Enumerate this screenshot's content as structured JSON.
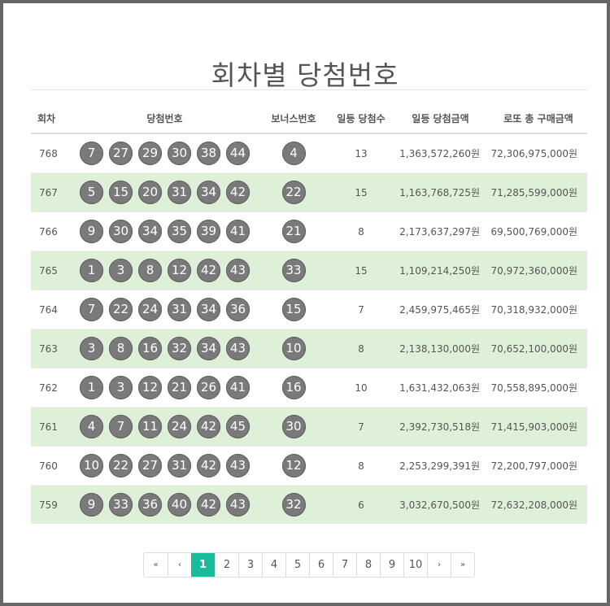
{
  "title": "회차별 당첨번호",
  "columns": {
    "round": "회차",
    "numbers": "당첨번호",
    "bonus": "보너스번호",
    "winners": "일등 당첨수",
    "prize": "일등 당첨금액",
    "total": "로또 총 구매금액"
  },
  "rows": [
    {
      "round": "768",
      "numbers": [
        "7",
        "27",
        "29",
        "30",
        "38",
        "44"
      ],
      "bonus": "4",
      "winners": "13",
      "prize": "1,363,572,260원",
      "total": "72,306,975,000원"
    },
    {
      "round": "767",
      "numbers": [
        "5",
        "15",
        "20",
        "31",
        "34",
        "42"
      ],
      "bonus": "22",
      "winners": "15",
      "prize": "1,163,768,725원",
      "total": "71,285,599,000원"
    },
    {
      "round": "766",
      "numbers": [
        "9",
        "30",
        "34",
        "35",
        "39",
        "41"
      ],
      "bonus": "21",
      "winners": "8",
      "prize": "2,173,637,297원",
      "total": "69,500,769,000원"
    },
    {
      "round": "765",
      "numbers": [
        "1",
        "3",
        "8",
        "12",
        "42",
        "43"
      ],
      "bonus": "33",
      "winners": "15",
      "prize": "1,109,214,250원",
      "total": "70,972,360,000원"
    },
    {
      "round": "764",
      "numbers": [
        "7",
        "22",
        "24",
        "31",
        "34",
        "36"
      ],
      "bonus": "15",
      "winners": "7",
      "prize": "2,459,975,465원",
      "total": "70,318,932,000원"
    },
    {
      "round": "763",
      "numbers": [
        "3",
        "8",
        "16",
        "32",
        "34",
        "43"
      ],
      "bonus": "10",
      "winners": "8",
      "prize": "2,138,130,000원",
      "total": "70,652,100,000원"
    },
    {
      "round": "762",
      "numbers": [
        "1",
        "3",
        "12",
        "21",
        "26",
        "41"
      ],
      "bonus": "16",
      "winners": "10",
      "prize": "1,631,432,063원",
      "total": "70,558,895,000원"
    },
    {
      "round": "761",
      "numbers": [
        "4",
        "7",
        "11",
        "24",
        "42",
        "45"
      ],
      "bonus": "30",
      "winners": "7",
      "prize": "2,392,730,518원",
      "total": "71,415,903,000원"
    },
    {
      "round": "760",
      "numbers": [
        "10",
        "22",
        "27",
        "31",
        "42",
        "43"
      ],
      "bonus": "12",
      "winners": "8",
      "prize": "2,253,299,391원",
      "total": "72,200,797,000원"
    },
    {
      "round": "759",
      "numbers": [
        "9",
        "33",
        "36",
        "40",
        "42",
        "43"
      ],
      "bonus": "32",
      "winners": "6",
      "prize": "3,032,670,500원",
      "total": "72,632,208,000원"
    }
  ],
  "pagination": {
    "first": "«",
    "prev": "‹",
    "next": "›",
    "last": "»",
    "pages": [
      "1",
      "2",
      "3",
      "4",
      "5",
      "6",
      "7",
      "8",
      "9",
      "10"
    ],
    "current": "1"
  },
  "colors": {
    "ball": "#7a7a7a",
    "alt_row": "#dff0d8",
    "active_page": "#18bc9c",
    "frame": "#666666"
  }
}
